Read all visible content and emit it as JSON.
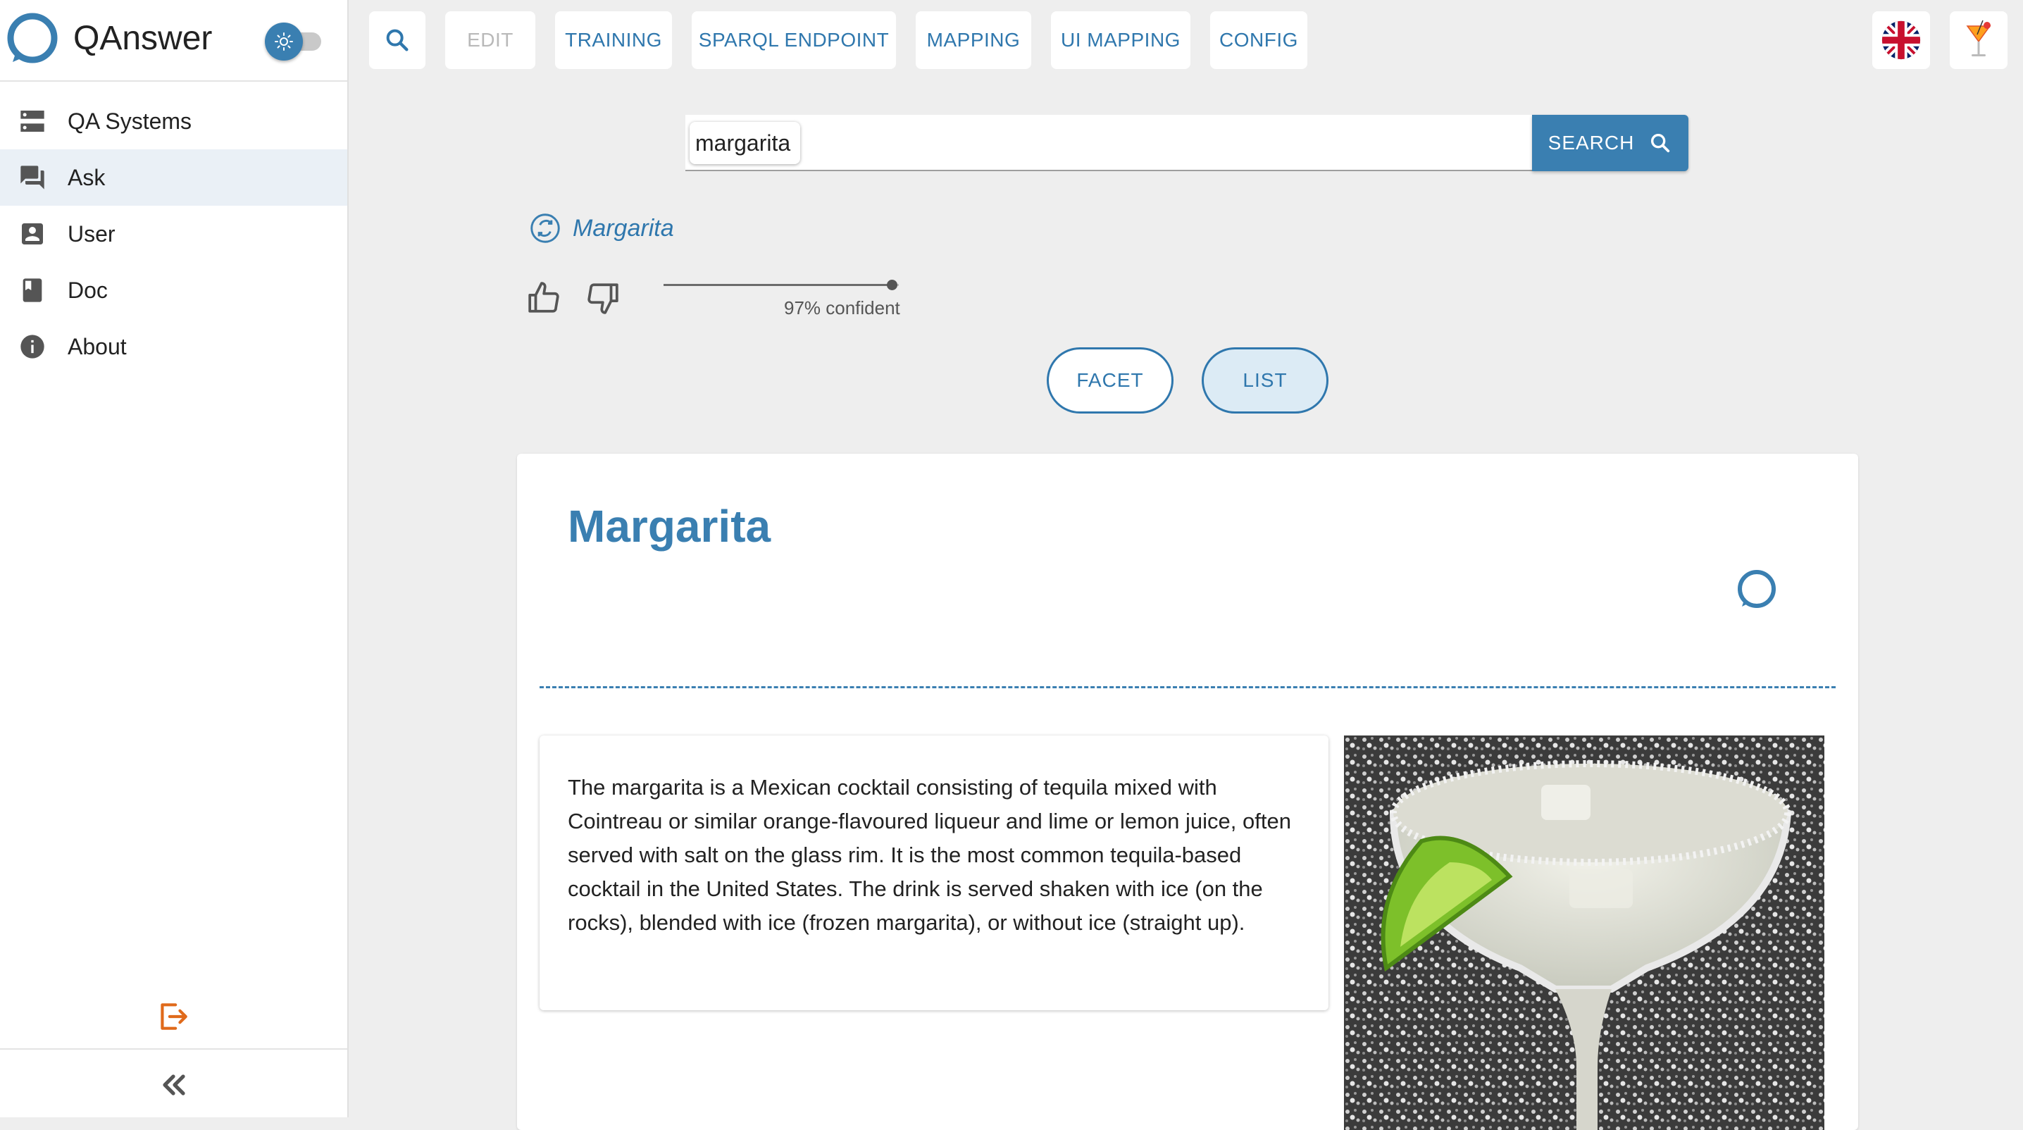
{
  "app": {
    "title": "QAnswer"
  },
  "sidebar": {
    "items": [
      {
        "label": "QA Systems",
        "icon": "server-icon"
      },
      {
        "label": "Ask",
        "icon": "forum-icon",
        "active": true
      },
      {
        "label": "User",
        "icon": "account-box-icon"
      },
      {
        "label": "Doc",
        "icon": "book-icon"
      },
      {
        "label": "About",
        "icon": "info-icon"
      }
    ],
    "logout_icon": "logout-icon",
    "collapse_icon": "double-chevron-left-icon"
  },
  "toolbar": {
    "buttons": [
      {
        "label": "EDIT",
        "disabled": true
      },
      {
        "label": "TRAINING"
      },
      {
        "label": "SPARQL ENDPOINT"
      },
      {
        "label": "MAPPING"
      },
      {
        "label": "UI MAPPING"
      },
      {
        "label": "CONFIG"
      }
    ],
    "language_icon": "uk-flag-icon",
    "user_icon": "cocktail-icon"
  },
  "search": {
    "query": "margarita",
    "button_label": "SEARCH"
  },
  "answer": {
    "link_text": "Margarita",
    "confidence_label": "97% confident",
    "confidence": 0.97
  },
  "view_toggle": {
    "facet_label": "FACET",
    "list_label": "LIST",
    "selected": "LIST"
  },
  "result": {
    "title": "Margarita",
    "abstract": "The margarita is a Mexican cocktail consisting of tequila mixed with Cointreau or similar orange-flavoured liqueur and lime or lemon juice, often served with salt on the glass rim. It is the most common tequila-based cocktail in the United States. The drink is served shaken with ice (on the rocks), blended with ice (frozen margarita), or without ice (straight up).",
    "image": "margarita-photo"
  },
  "colors": {
    "primary": "#3a7fb1",
    "accent_logout": "#e06a1b",
    "background": "#eeeeee"
  }
}
